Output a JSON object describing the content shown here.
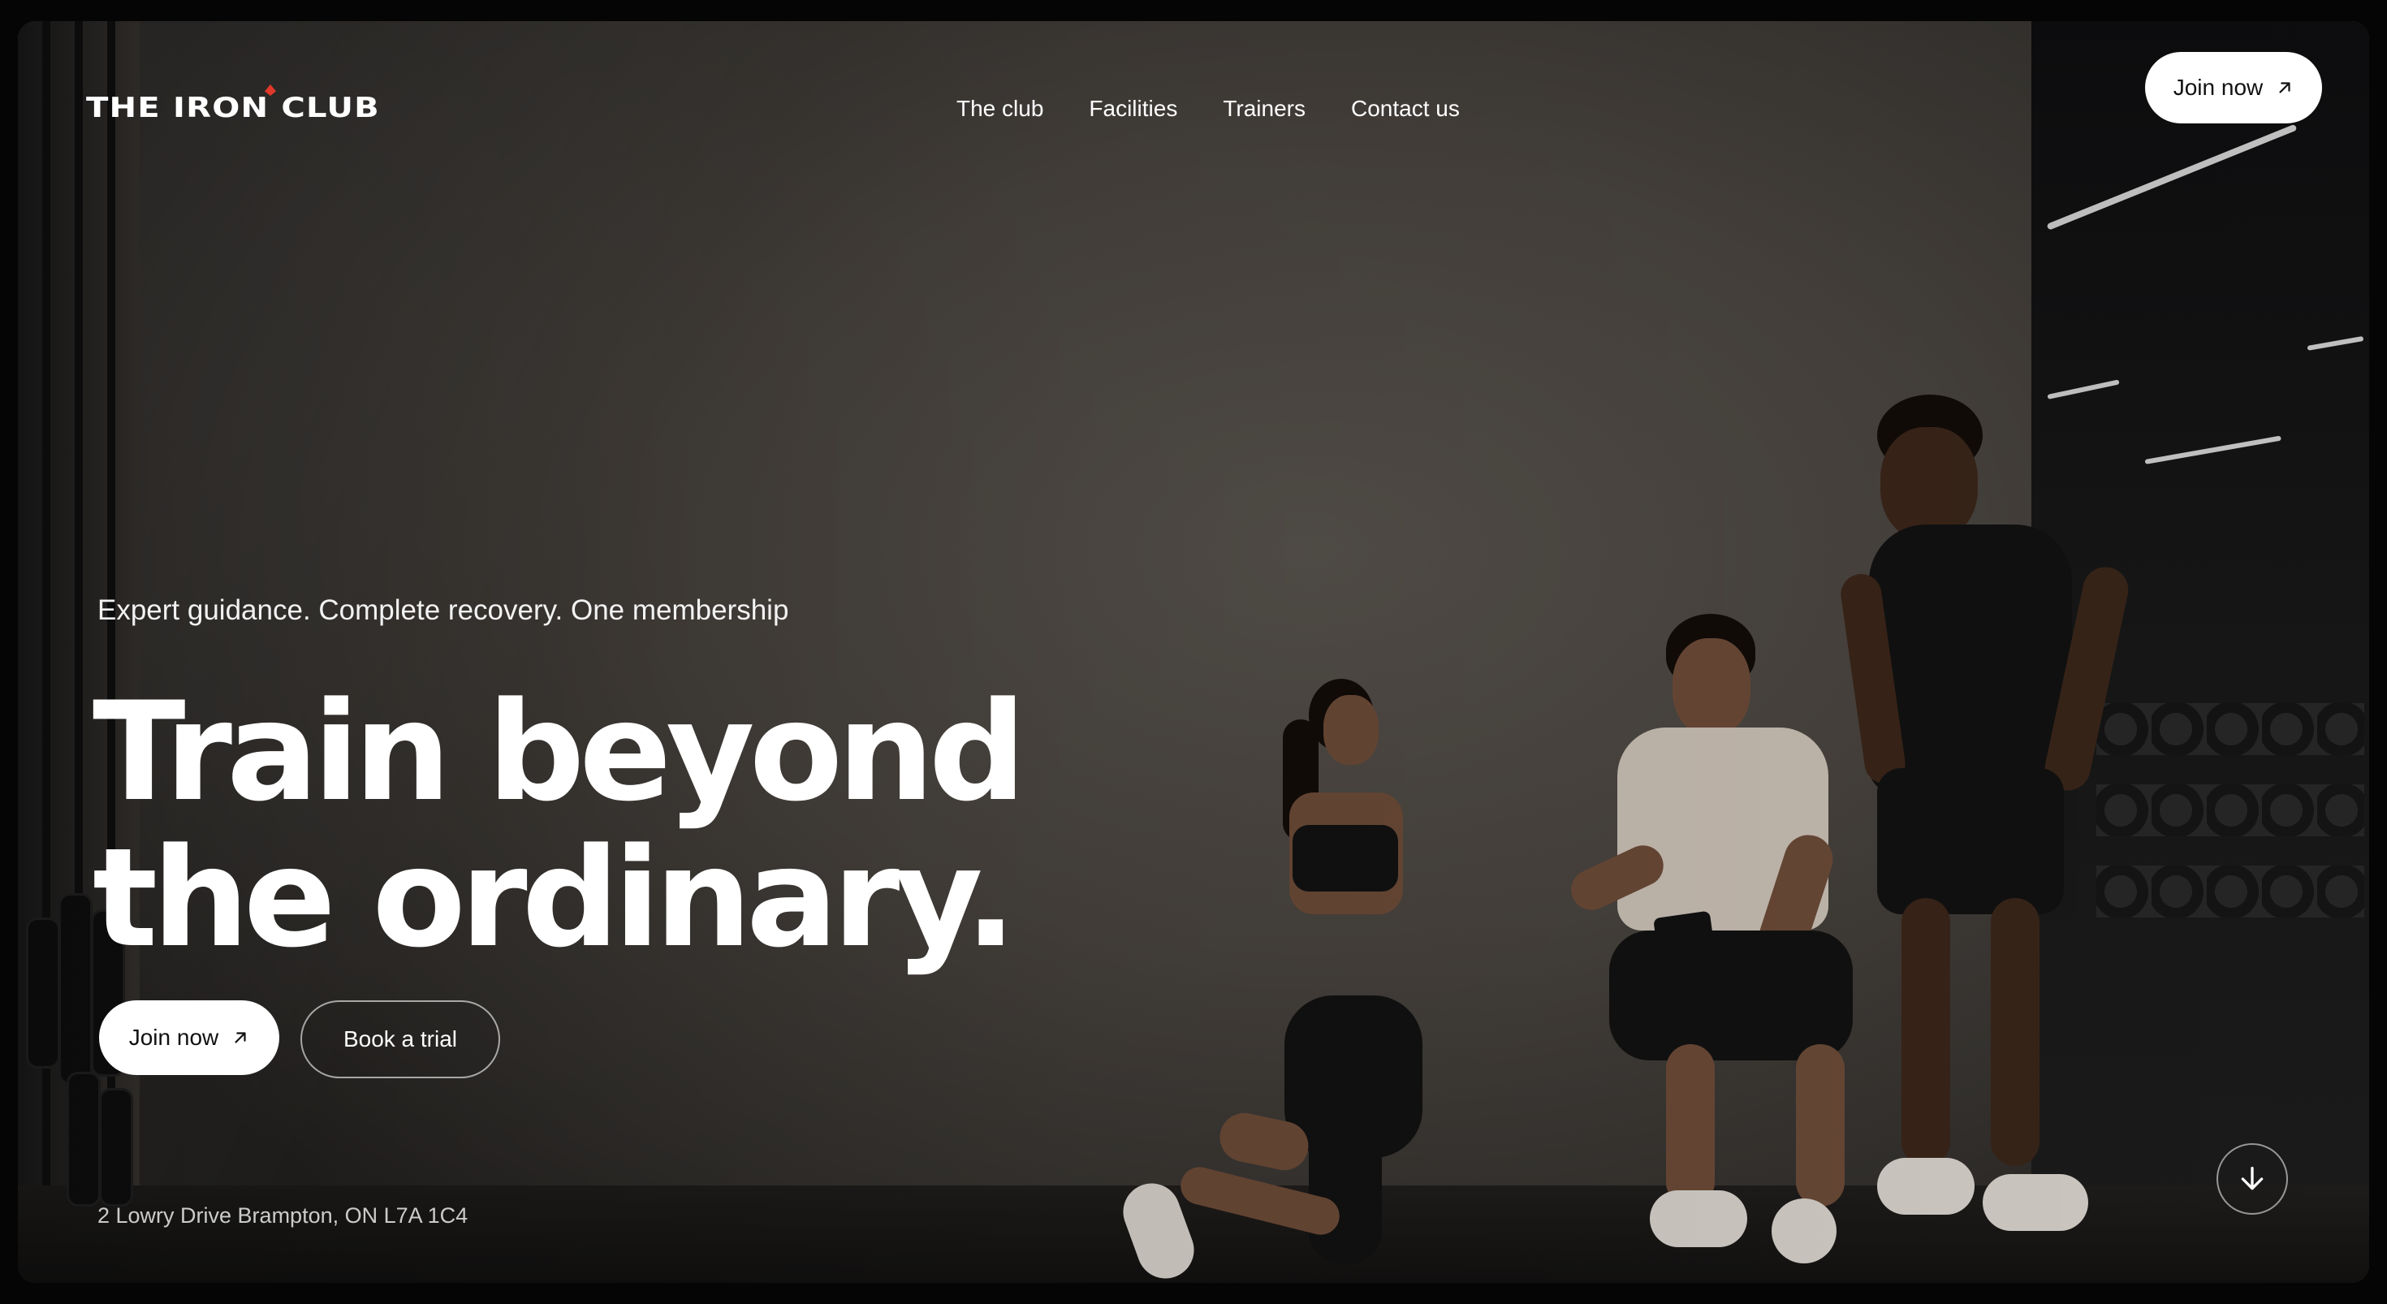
{
  "brand": {
    "name": "THE IRON CLUB",
    "accent_color": "#e0392b"
  },
  "nav": {
    "items": [
      {
        "label": "The club"
      },
      {
        "label": "Facilities"
      },
      {
        "label": "Trainers"
      },
      {
        "label": "Contact us"
      }
    ]
  },
  "header": {
    "join_label": "Join now",
    "join_icon": "arrow-up-right-icon"
  },
  "hero": {
    "tagline": "Expert guidance. Complete recovery. One membership",
    "title_line_1": "Train beyond",
    "title_line_2": "the ordinary.",
    "primary_cta": "Join now",
    "primary_cta_icon": "arrow-up-right-icon",
    "secondary_cta": "Book a trial",
    "address": "2 Lowry Drive Brampton, ON L7A 1C4",
    "scroll_icon": "arrow-down-icon"
  },
  "image": {
    "scene": "hero-photo-trainers"
  }
}
